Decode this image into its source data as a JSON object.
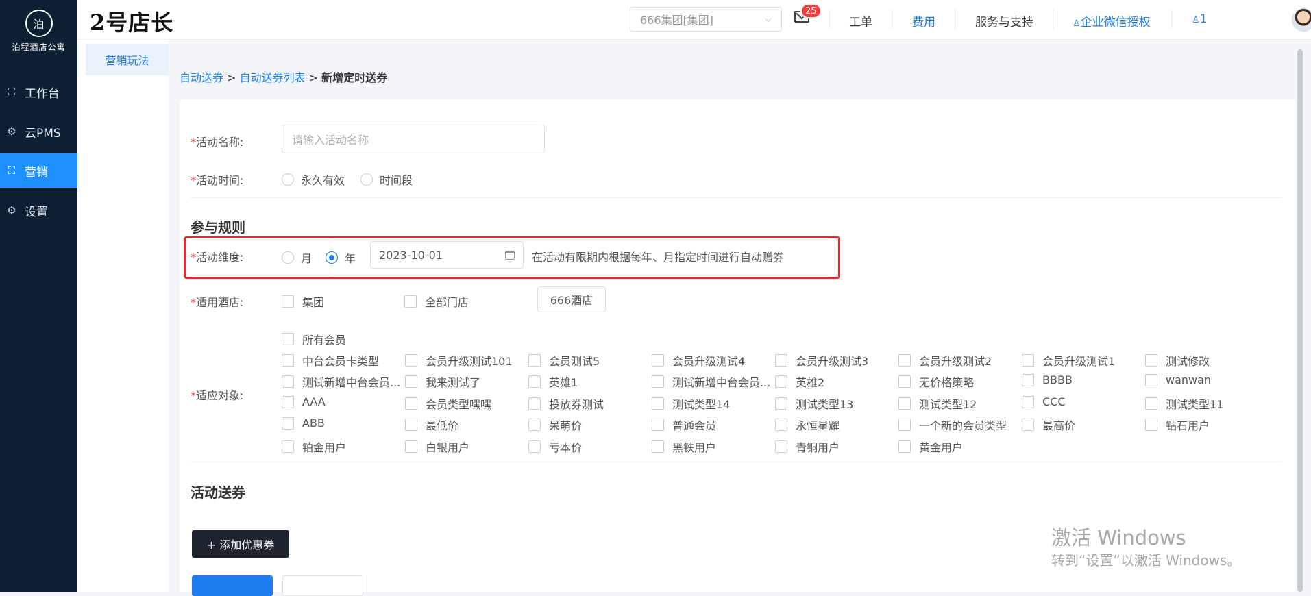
{
  "sidebar": {
    "logo_mark": "泊",
    "logo_text": "泊程酒店公寓",
    "items": [
      {
        "label": "工作台",
        "icon": "grid-icon"
      },
      {
        "label": "云PMS",
        "icon": "gear-icon"
      },
      {
        "label": "营销",
        "icon": "grid-icon",
        "active": true
      },
      {
        "label": "设置",
        "icon": "gear-icon"
      }
    ]
  },
  "header": {
    "brand": "2号店长",
    "group_select": "666集团[集团]",
    "mail_badge": "25",
    "links": {
      "ticket": "工单",
      "fee": "费用",
      "service": "服务与支持",
      "wechat": "企业微信授权",
      "user": "1"
    }
  },
  "subnav": {
    "item": "营销玩法"
  },
  "breadcrumb": {
    "item1": "自动送券",
    "item2": "自动送券列表",
    "sep": ">",
    "current": "新增定时送券"
  },
  "form": {
    "name_label": "活动名称:",
    "name_placeholder": "请输入活动名称",
    "time_label": "活动时间:",
    "time_options": [
      "永久有效",
      "时间段"
    ],
    "rules_title": "参与规则",
    "dimension_label": "活动维度:",
    "dimension_options": [
      "月",
      "年"
    ],
    "date_value": "2023-10-01",
    "dimension_hint": "在活动有限期内根据每年、月指定时间进行自动赠券",
    "hotel_label": "适用酒店:",
    "hotel_options": [
      "集团",
      "全部门店"
    ],
    "hotel_button": "666酒店",
    "target_label": "适应对象:",
    "all_members": "所有会员",
    "members": [
      "中台会员卡类型",
      "会员升级测试101",
      "会员测试5",
      "会员升级测试4",
      "会员升级测试3",
      "会员升级测试2",
      "会员升级测试1",
      "测试修改",
      "测试新增中台会员...",
      "我来测试了",
      "英雄1",
      "测试新增中台会员...",
      "英雄2",
      "无价格策略",
      "BBBB",
      "wanwan",
      "AAA",
      "会员类型嘿嘿",
      "投放券测试",
      "测试类型14",
      "测试类型13",
      "测试类型12",
      "CCC",
      "测试类型11",
      "ABB",
      "最低价",
      "呆萌价",
      "普通会员",
      "永恒星耀",
      "一个新的会员类型",
      "最高价",
      "钻石用户",
      "铂金用户",
      "白银用户",
      "亏本价",
      "黑铁用户",
      "青铜用户",
      "黄金用户"
    ],
    "coupon_title": "活动送券",
    "add_coupon": "+ 添加优惠券"
  },
  "watermark": {
    "line1": "激活 Windows",
    "line2": "转到“设置”以激活 Windows。"
  }
}
